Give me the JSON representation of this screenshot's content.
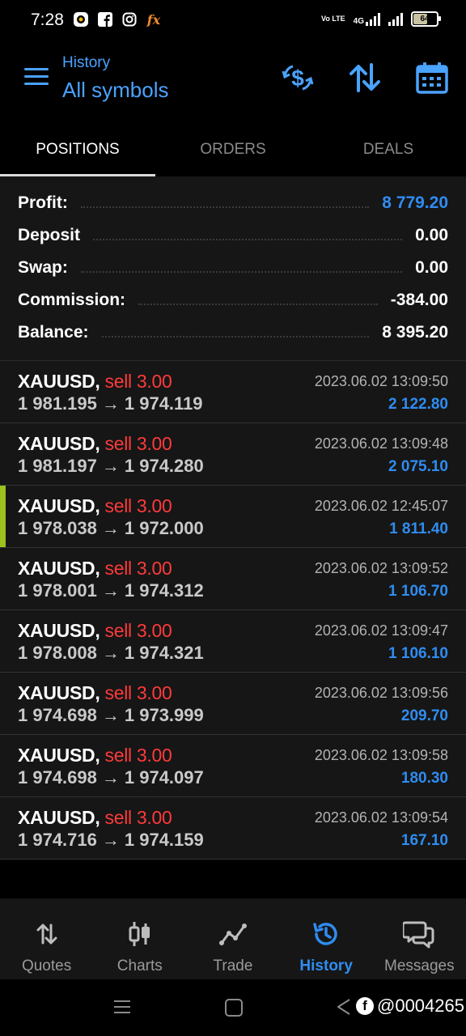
{
  "status_bar": {
    "time": "7:28",
    "network": "4G",
    "volte": "Vo LTE",
    "battery": "64",
    "battery_level": 0.64
  },
  "header": {
    "subtitle": "History",
    "title": "All symbols",
    "accent_color": "#4aa3ff",
    "actions": [
      "currency-exchange-icon",
      "sort-icon",
      "calendar-icon"
    ]
  },
  "tabs": [
    {
      "label": "POSITIONS",
      "active": true
    },
    {
      "label": "ORDERS",
      "active": false
    },
    {
      "label": "DEALS",
      "active": false
    }
  ],
  "summary": {
    "profit": {
      "label": "Profit:",
      "value": "8 779.20"
    },
    "deposit": {
      "label": "Deposit",
      "value": "0.00"
    },
    "swap": {
      "label": "Swap:",
      "value": "0.00"
    },
    "commission": {
      "label": "Commission:",
      "value": "-384.00"
    },
    "balance": {
      "label": "Balance:",
      "value": "8 395.20"
    }
  },
  "positions": [
    {
      "symbol": "XAUUSD,",
      "side": "sell 3.00",
      "open": "1 981.195",
      "close": "1 974.119",
      "time": "2023.06.02 13:09:50",
      "profit": "2 122.80"
    },
    {
      "symbol": "XAUUSD,",
      "side": "sell 3.00",
      "open": "1 981.197",
      "close": "1 974.280",
      "time": "2023.06.02 13:09:48",
      "profit": "2 075.10"
    },
    {
      "symbol": "XAUUSD,",
      "side": "sell 3.00",
      "open": "1 978.038",
      "close": "1 972.000",
      "time": "2023.06.02 12:45:07",
      "profit": "1 811.40",
      "marked": true
    },
    {
      "symbol": "XAUUSD,",
      "side": "sell 3.00",
      "open": "1 978.001",
      "close": "1 974.312",
      "time": "2023.06.02 13:09:52",
      "profit": "1 106.70"
    },
    {
      "symbol": "XAUUSD,",
      "side": "sell 3.00",
      "open": "1 978.008",
      "close": "1 974.321",
      "time": "2023.06.02 13:09:47",
      "profit": "1 106.10"
    },
    {
      "symbol": "XAUUSD,",
      "side": "sell 3.00",
      "open": "1 974.698",
      "close": "1 973.999",
      "time": "2023.06.02 13:09:56",
      "profit": "209.70"
    },
    {
      "symbol": "XAUUSD,",
      "side": "sell 3.00",
      "open": "1 974.698",
      "close": "1 974.097",
      "time": "2023.06.02 13:09:58",
      "profit": "180.30"
    },
    {
      "symbol": "XAUUSD,",
      "side": "sell 3.00",
      "open": "1 974.716",
      "close": "1 974.159",
      "time": "2023.06.02 13:09:54",
      "profit": "167.10"
    }
  ],
  "arrow": "→",
  "colors": {
    "profit_blue": "#2f8cf0",
    "sell_red": "#ff3a3a",
    "marker_green": "#9bc21d"
  },
  "bottom_nav": [
    {
      "label": "Quotes",
      "icon": "quotes-icon",
      "active": false
    },
    {
      "label": "Charts",
      "icon": "charts-icon",
      "active": false
    },
    {
      "label": "Trade",
      "icon": "trade-icon",
      "active": false
    },
    {
      "label": "History",
      "icon": "history-icon",
      "active": true
    },
    {
      "label": "Messages",
      "icon": "messages-icon",
      "active": false
    }
  ],
  "watermark": "@0004265"
}
